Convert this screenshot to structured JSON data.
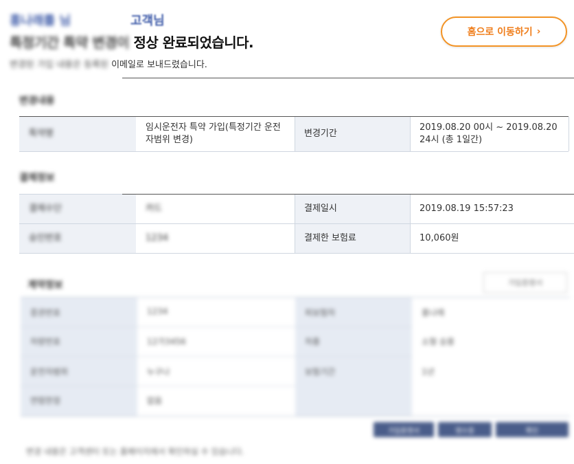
{
  "header": {
    "greeting_name": "홍나래를 님",
    "greeting_suffix": "고객님",
    "headline_blurred": "특정기간 특약 변경이",
    "headline_visible": " 정상 완료되었습니다.",
    "subline_blurred": "변경된 가입 내용은 등록된 ",
    "subline_visible": "이메일로 보내드렸습니다."
  },
  "home_button": {
    "label": "홈으로 이동하기",
    "chevron": "›"
  },
  "change_section": {
    "title": "변경내용",
    "row": {
      "label": "특약명",
      "value": "임시운전자 특약 가입(특정기간 운전자범위 변경)",
      "period_label": "변경기간",
      "period_value": "2019.08.20 00시 ~ 2019.08.20 24시 (총 1일간)"
    }
  },
  "payment_section": {
    "title": "결제정보",
    "rows": [
      {
        "label": "결제수단",
        "value": "카드",
        "right_label": "결제일시",
        "right_value": "2019.08.19 15:57:23"
      },
      {
        "label": "승인번호",
        "value": "1234",
        "right_label": "결제한 보험료",
        "right_value": "10,060원"
      }
    ]
  },
  "contract_section": {
    "title": "계약정보",
    "top_right_button": "가입증명서",
    "rows": [
      {
        "label": "증권번호",
        "value": "1234",
        "right_label": "피보험자",
        "right_value": "홍나래"
      },
      {
        "label": "차량번호",
        "value": "12가3456",
        "right_label": "차종",
        "right_value": "소형 승용"
      },
      {
        "label": "운전자범위",
        "value": "누구나",
        "right_label": "보험기간",
        "right_value": "1년"
      },
      {
        "label": "연령한정",
        "value": "없음",
        "right_label": "",
        "right_value": ""
      }
    ]
  },
  "bottom_buttons": [
    "가입증명서",
    "영수증",
    "확인"
  ],
  "footer_note": "변경 내용은 고객센터 또는 홈페이지에서 확인하실 수 있습니다."
}
